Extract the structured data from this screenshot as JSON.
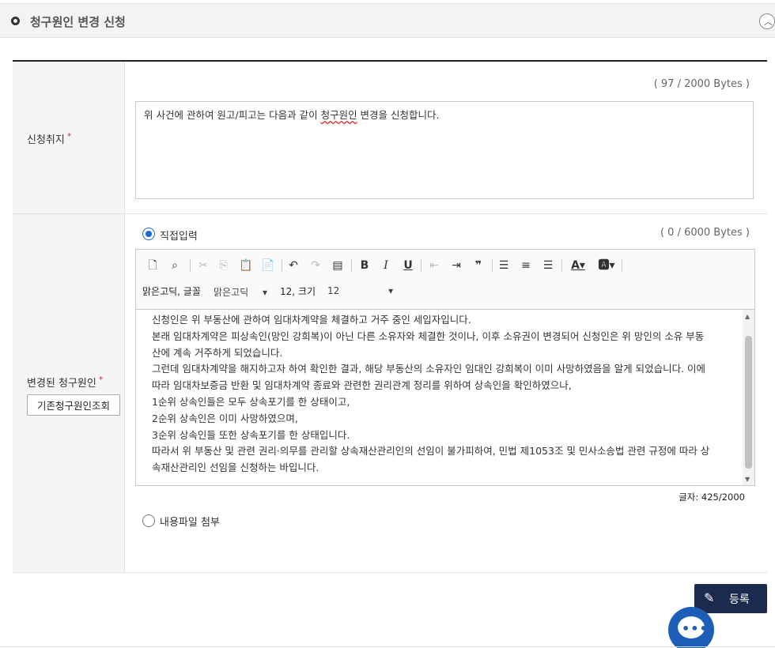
{
  "section": {
    "title": "청구원인 변경 신청"
  },
  "purpose": {
    "label": "신청취지",
    "required_mark": "*",
    "byte_count": "( 97 / 2000 Bytes )",
    "text_before": "위 사건에 관하여 원고/피고는 다음과 같이 ",
    "text_spell": "청구원인",
    "text_after": " 변경을 신청합니다."
  },
  "changed_cause": {
    "label": "변경된 청구원인",
    "required_mark": "*",
    "lookup_button": "기존청구원인조회",
    "radio_direct": "직접입력",
    "radio_file": "내용파일 첨부",
    "byte_count": "( 0 / 6000 Bytes )",
    "editor": {
      "font_label": "맑은고딕, 글꼴",
      "font_value": "맑은고딕",
      "size_label": "12, 크기",
      "size_value": "12",
      "lines": [
        "신청인은 위 부동산에 관하여 임대차계약을 체결하고 거주 중인 세입자입니다.",
        "본래 임대차계약은 피상속인(망인 강희복)이 아닌 다른 소유자와 체결한 것이나, 이후 소유권이 변경되어 신청인은 위 망인의 소유 부동",
        "산에 계속 거주하게 되었습니다.",
        "그런데 임대차계약을 해지하고자 하여 확인한 결과, 해당 부동산의 소유자인 임대인 강희복이 이미 사망하였음을 알게 되었습니다. 이에",
        "따라 임대차보증금 반환 및 임대차계약 종료와 관련한 권리관계 정리를 위하여 상속인을 확인하였으나,",
        "1순위 상속인들은 모두 상속포기를 한 상태이고,",
        "2순위 상속인은 이미 사망하였으며,",
        "3순위 상속인들 또한 상속포기를 한 상태입니다.",
        "따라서 위 부동산 및 관련 권리·의무를 관리할 상속재산관리인의 선임이 불가피하여, 민법 제1053조 및 민사소송법 관련 규정에 따라 상",
        "속재산관리인 선임을 신청하는 바입니다."
      ]
    },
    "char_count": "글자: 425/2000"
  },
  "submit_button": "등록"
}
